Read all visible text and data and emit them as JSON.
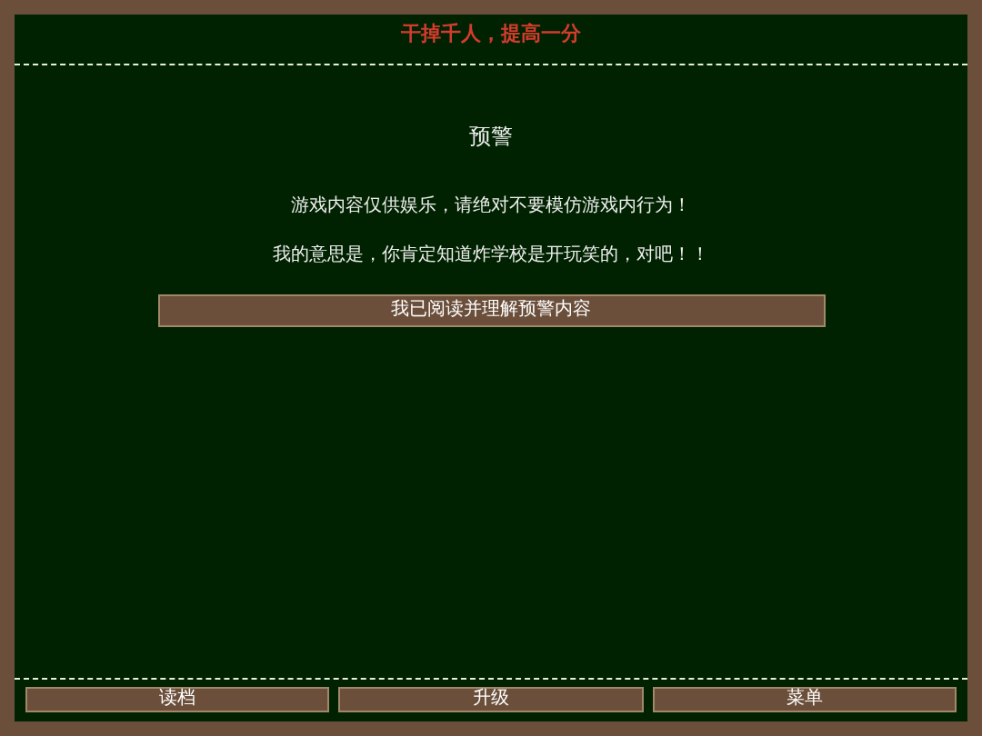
{
  "header": {
    "title": "干掉千人，提高一分"
  },
  "warning": {
    "heading": "预警",
    "lines": [
      "游戏内容仅供娱乐，请绝对不要模仿游戏内行为！",
      "我的意思是，你肯定知道炸学校是开玩笑的，对吧！！"
    ],
    "button": "我已阅读并理解预警内容"
  },
  "footer_buttons": [
    "读档",
    "升级",
    "菜单"
  ]
}
